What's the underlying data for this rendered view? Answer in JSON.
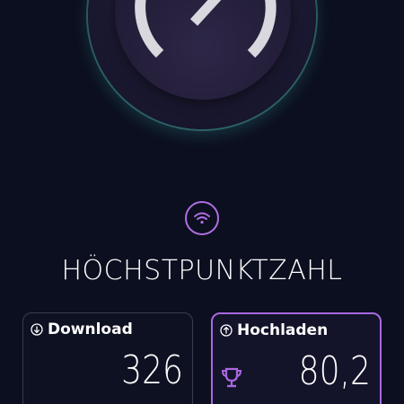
{
  "speedometer": {
    "icon": "speedometer-icon",
    "ring_color": "#5ac8be"
  },
  "status": {
    "icon": "wifi-icon",
    "accent": "#b06ee0"
  },
  "title": "HÖCHSTPUNKTZAHL",
  "cards": {
    "download": {
      "label": "Download",
      "icon": "arrow-down-circle-icon",
      "value": "326"
    },
    "upload": {
      "label": "Hochladen",
      "icon": "arrow-up-circle-icon",
      "badge_icon": "trophy-icon",
      "value": "80,2",
      "accent": "#a868e0"
    }
  }
}
